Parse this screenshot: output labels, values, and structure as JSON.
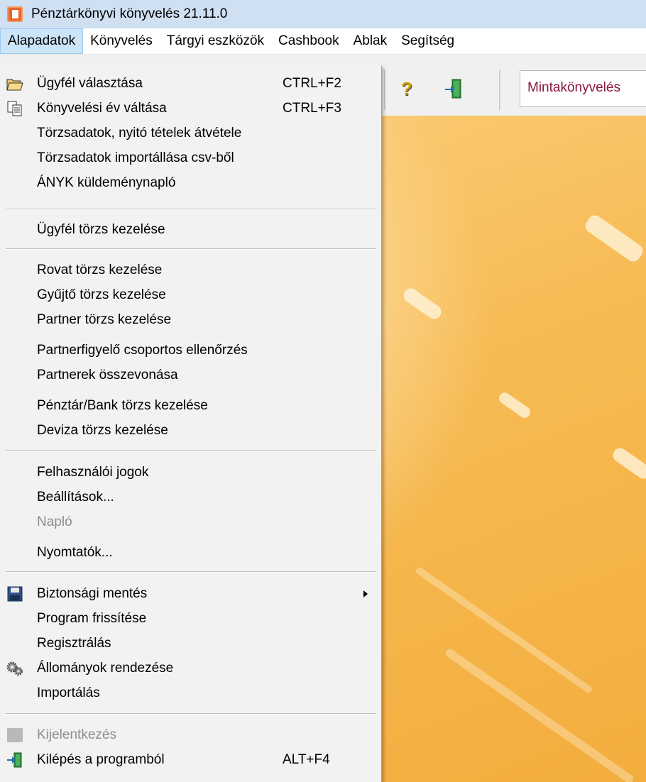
{
  "window": {
    "title": "Pénztárkönyvi könyvelés 21.11.0",
    "icon": "app-logo-icon"
  },
  "menubar": {
    "items": [
      {
        "label": "Alapadatok",
        "active": true
      },
      {
        "label": "Könyvelés"
      },
      {
        "label": "Tárgyi eszközök"
      },
      {
        "label": "Cashbook"
      },
      {
        "label": "Ablak"
      },
      {
        "label": "Segítség"
      }
    ]
  },
  "toolbar": {
    "help_icon": "help-icon",
    "exit_icon": "exit-door-icon",
    "company_name": "Mintakönyvelés"
  },
  "dropdown": {
    "items": [
      {
        "label": "Ügyfél választása",
        "shortcut": "CTRL+F2",
        "icon": "open-folder-icon"
      },
      {
        "label": "Könyvelési év váltása",
        "shortcut": "CTRL+F3",
        "icon": "copy-documents-icon"
      },
      {
        "label": "Törzsadatok, nyitó tételek átvétele"
      },
      {
        "label": "Törzsadatok importállása csv-ből"
      },
      {
        "label": "ÁNYK küldeménynapló"
      },
      {
        "label": "Ügyfél törzs kezelése"
      },
      {
        "label": "Rovat törzs kezelése"
      },
      {
        "label": "Gyűjtő törzs kezelése"
      },
      {
        "label": "Partner törzs kezelése"
      },
      {
        "label": "Partnerfigyelő csoportos ellenőrzés"
      },
      {
        "label": "Partnerek összevonása"
      },
      {
        "label": "Pénztár/Bank törzs kezelése"
      },
      {
        "label": "Deviza törzs kezelése"
      },
      {
        "label": "Felhasználói jogok"
      },
      {
        "label": "Beállítások..."
      },
      {
        "label": "Napló",
        "disabled": true
      },
      {
        "label": "Nyomtatók..."
      },
      {
        "label": "Biztonsági mentés",
        "icon": "floppy-disk-icon",
        "submenu": true
      },
      {
        "label": "Program frissítése"
      },
      {
        "label": "Regisztrálás"
      },
      {
        "label": "Állományok rendezése",
        "icon": "gears-icon"
      },
      {
        "label": "Importálás"
      },
      {
        "label": "Kijelentkezés",
        "disabled": true,
        "icon": "logout-icon"
      },
      {
        "label": "Kilépés a programból",
        "shortcut": "ALT+F4",
        "icon": "exit-door-icon"
      }
    ]
  },
  "colors": {
    "titlebar": "#cfe0f3",
    "menu_highlight": "#cce4f7",
    "company_text": "#8a1640",
    "workspace_orange": "#f7bb54"
  }
}
